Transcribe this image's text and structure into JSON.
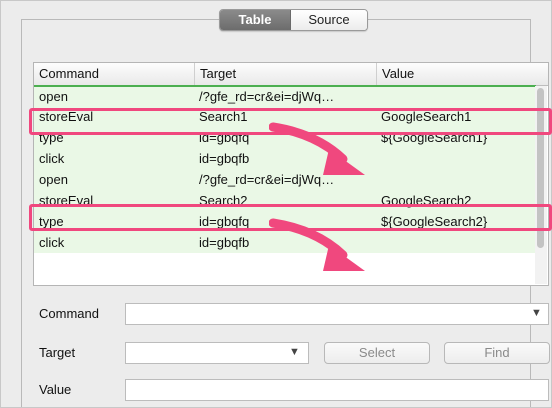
{
  "tabs": {
    "table": "Table",
    "source": "Source"
  },
  "table": {
    "headers": {
      "command": "Command",
      "target": "Target",
      "value": "Value"
    },
    "rows": [
      {
        "command": "open",
        "target": "/?gfe_rd=cr&ei=djWq…",
        "value": ""
      },
      {
        "command": "storeEval",
        "target": "Search1",
        "value": "GoogleSearch1"
      },
      {
        "command": "type",
        "target": "id=gbqfq",
        "value": "${GoogleSearch1}"
      },
      {
        "command": "click",
        "target": "id=gbqfb",
        "value": ""
      },
      {
        "command": "open",
        "target": "/?gfe_rd=cr&ei=djWq…",
        "value": ""
      },
      {
        "command": "storeEval",
        "target": "Search2",
        "value": "GoogleSearch2"
      },
      {
        "command": "type",
        "target": "id=gbqfq",
        "value": "${GoogleSearch2}"
      },
      {
        "command": "click",
        "target": "id=gbqfb",
        "value": ""
      }
    ]
  },
  "form": {
    "command_label": "Command",
    "target_label": "Target",
    "value_label": "Value",
    "select_button": "Select",
    "find_button": "Find",
    "command_value": "",
    "target_value": "",
    "value_value": "",
    "dropdown_glyph": "▼"
  },
  "colors": {
    "highlight": "#f0487e",
    "row_bg": "#eaf8e6",
    "current_row_line": "#4caf50"
  },
  "icons": {
    "dropdown": "chevron-down-icon",
    "annotation_arrow": "arrow-icon"
  }
}
